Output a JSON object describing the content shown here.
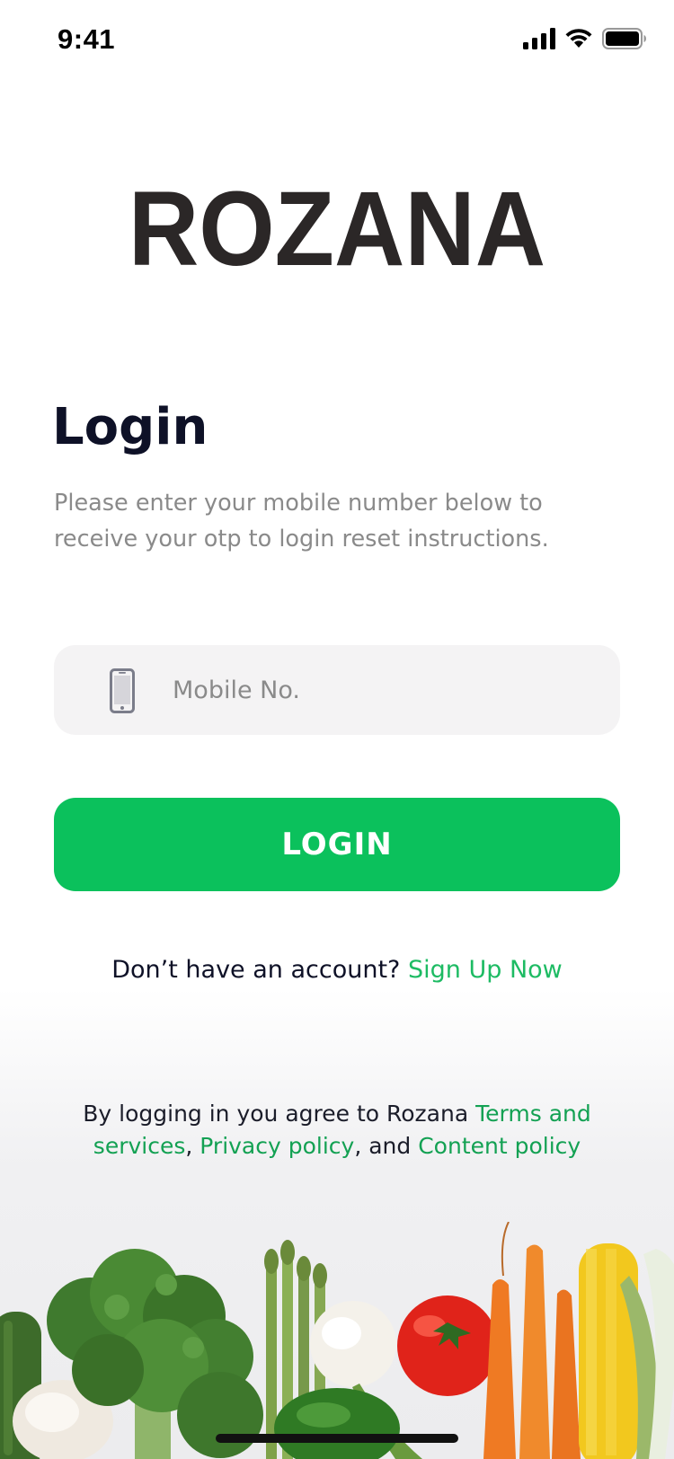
{
  "status_bar": {
    "time": "9:41",
    "icons": [
      "cellular-signal-icon",
      "wifi-icon",
      "battery-icon"
    ]
  },
  "brand": {
    "logo_text": "ROZANA"
  },
  "login": {
    "title": "Login",
    "description": "Please enter your mobile number below to receive your otp to login reset instructions.",
    "mobile_placeholder": "Mobile No.",
    "mobile_value": "",
    "button_label": "LOGIN"
  },
  "signup": {
    "prompt": "Don’t have an account? ",
    "link": "Sign Up Now"
  },
  "terms": {
    "prefix": "By logging in you agree to Rozana ",
    "terms_link": "Terms and services",
    "separator_1": ", ",
    "privacy_link": "Privacy policy",
    "separator_2": ", and ",
    "content_link": "Content policy"
  },
  "colors": {
    "accent_green": "#0bc15c",
    "link_green": "#1dbb63",
    "title_navy": "#0e1127",
    "logo_dark": "#2b2727",
    "input_bg": "#f4f3f4"
  },
  "decoration": {
    "icon": "vegetables-illustration"
  }
}
